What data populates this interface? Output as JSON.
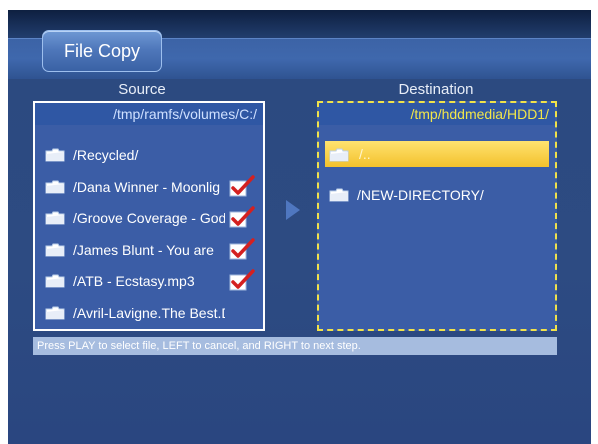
{
  "title": "File Copy",
  "source": {
    "header": "Source",
    "path": "/tmp/ramfs/volumes/C:/",
    "items": [
      {
        "label": "/Recycled/",
        "checked": false
      },
      {
        "label": "/Dana Winner - Moonlig",
        "checked": true
      },
      {
        "label": "/Groove Coverage - God",
        "checked": true
      },
      {
        "label": "/James Blunt - You are",
        "checked": true
      },
      {
        "label": "/ATB - Ecstasy.mp3",
        "checked": true
      },
      {
        "label": "/Avril-Lavigne.The Best.D",
        "checked": false
      }
    ]
  },
  "destination": {
    "header": "Destination",
    "path": "/tmp/hddmedia/HDD1/",
    "items": [
      {
        "label": "/..",
        "selected": true
      },
      {
        "label": "/NEW-DIRECTORY/",
        "selected": false
      }
    ]
  },
  "hint": "Press PLAY to select file, LEFT to cancel, and RIGHT to next step.",
  "icons": {
    "folder": "folder-icon",
    "check": "checkmark-icon",
    "arrow": "right-arrow-icon"
  },
  "colors": {
    "panel": "#3b5da6",
    "highlight": "#f3c12c",
    "dest_border": "#f1e24a",
    "check": "#d42020"
  }
}
